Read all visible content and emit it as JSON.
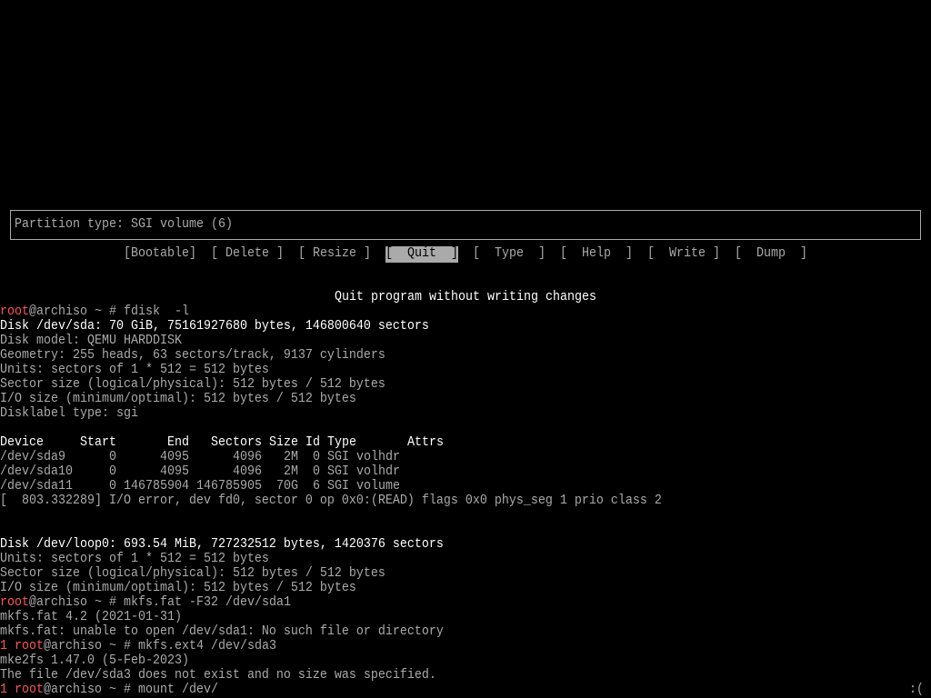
{
  "colors": {
    "background": "#000000",
    "text": "#aaaaaa",
    "bright": "#ffffff",
    "prompt_user": "#ff5555",
    "selected_bg": "#aaaaaa",
    "selected_text": "#000000"
  },
  "cfdisk": {
    "info_box": "Partition type: SGI volume (6)",
    "menu": [
      {
        "label": "[Bootable]",
        "selected": false
      },
      {
        "label": "[ Delete ]",
        "selected": false
      },
      {
        "label": "[ Resize ]",
        "selected": false
      },
      {
        "label": "[  Quit  ]",
        "selected": true
      },
      {
        "label": "[  Type  ]",
        "selected": false
      },
      {
        "label": "[  Help  ]",
        "selected": false
      },
      {
        "label": "[  Write ]",
        "selected": false
      },
      {
        "label": "[  Dump  ]",
        "selected": false
      }
    ],
    "hint": "Quit program without writing changes"
  },
  "prompt": {
    "user": "root",
    "host": "@archiso ~ #"
  },
  "session": {
    "fdisk": {
      "command": "fdisk  -l",
      "disk": {
        "header": "Disk /dev/sda: 70 GiB, 75161927680 bytes, 146800640 sectors",
        "info": [
          "Disk model: QEMU HARDDISK",
          "Geometry: 255 heads, 63 sectors/track, 9137 cylinders",
          "Units: sectors of 1 * 512 = 512 bytes",
          "Sector size (logical/physical): 512 bytes / 512 bytes",
          "I/O size (minimum/optimal): 512 bytes / 512 bytes",
          "Disklabel type: sgi"
        ],
        "partition_table": {
          "columns": {
            "device": "Device",
            "start": "Start",
            "end": "End",
            "sectors": "Sectors",
            "size": "Size",
            "id": "Id",
            "type": "Type",
            "attrs": "Attrs"
          },
          "rows": [
            {
              "device": "/dev/sda9",
              "start": "0",
              "end": "4095",
              "sectors": "4096",
              "size": "2M",
              "id": "0",
              "type": "SGI volhdr"
            },
            {
              "device": "/dev/sda10",
              "start": "0",
              "end": "4095",
              "sectors": "4096",
              "size": "2M",
              "id": "0",
              "type": "SGI volhdr"
            },
            {
              "device": "/dev/sda11",
              "start": "0",
              "end": "146785904",
              "sectors": "146785905",
              "size": "70G",
              "id": "6",
              "type": "SGI volume"
            }
          ]
        }
      },
      "kernel_message": "[  803.332289] I/O error, dev fd0, sector 0 op 0x0:(READ) flags 0x0 phys_seg 1 prio class 2",
      "loop_disk": {
        "header": "Disk /dev/loop0: 693.54 MiB, 727232512 bytes, 1420376 sectors",
        "info": [
          "Units: sectors of 1 * 512 = 512 bytes",
          "Sector size (logical/physical): 512 bytes / 512 bytes",
          "I/O size (minimum/optimal): 512 bytes / 512 bytes"
        ]
      }
    },
    "mkfs_fat": {
      "command": "mkfs.fat -F32 /dev/sda1",
      "output": [
        "mkfs.fat 4.2 (2021-01-31)",
        "mkfs.fat: unable to open /dev/sda1: No such file or directory"
      ]
    },
    "mkfs_ext4": {
      "exit_status": "1",
      "command": "mkfs.ext4 /dev/sda3",
      "output": [
        "mke2fs 1.47.0 (5-Feb-2023)",
        "The file /dev/sda3 does not exist and no size was specified."
      ]
    },
    "current": {
      "exit_status": "1",
      "input": "mount /dev/",
      "right_prompt": ":("
    }
  }
}
